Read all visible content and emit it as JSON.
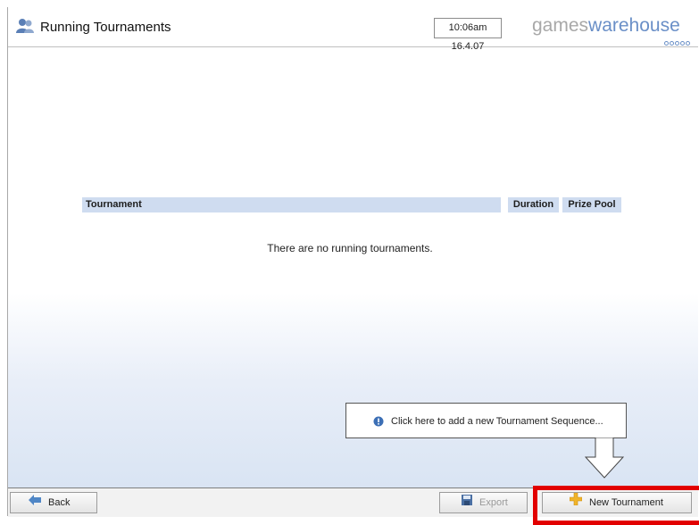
{
  "header": {
    "title": "Running Tournaments",
    "clock": "10:06am 16.4.07",
    "brand_games": "games",
    "brand_warehouse": "warehouse"
  },
  "table": {
    "columns": [
      "Tournament",
      "Duration",
      "Prize Pool"
    ],
    "empty_message": "There are no running tournaments."
  },
  "tooltip": {
    "text": "Click here to add a new Tournament Sequence..."
  },
  "footer": {
    "back_label": "Back",
    "export_label": "Export",
    "new_tournament_label": "New Tournament"
  },
  "colors": {
    "accent": "#6a8fc7",
    "table_header": "#cfdcf0",
    "highlight": "#e20000"
  },
  "icons": {
    "title": "users-icon",
    "tooltip": "info-bubble-icon",
    "back": "back-arrow-icon",
    "export": "save-disk-icon",
    "new": "plus-icon"
  }
}
